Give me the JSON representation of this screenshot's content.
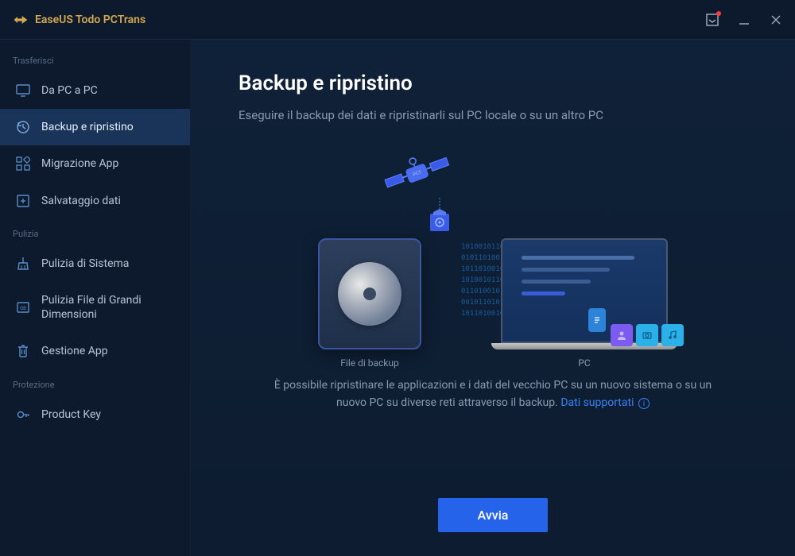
{
  "app": {
    "name": "EaseUS Todo PCTrans"
  },
  "sidebar": {
    "sections": [
      {
        "label": "Trasferisci",
        "items": [
          {
            "label": "Da PC a PC",
            "icon": "monitor-icon"
          },
          {
            "label": "Backup e ripristino",
            "icon": "restore-icon",
            "active": true
          },
          {
            "label": "Migrazione App",
            "icon": "apps-icon"
          },
          {
            "label": "Salvataggio dati",
            "icon": "save-icon"
          }
        ]
      },
      {
        "label": "Pulizia",
        "items": [
          {
            "label": "Pulizia di Sistema",
            "icon": "broom-icon"
          },
          {
            "label": "Pulizia File di Grandi Dimensioni",
            "icon": "large-file-icon"
          },
          {
            "label": "Gestione App",
            "icon": "trash-icon"
          }
        ]
      },
      {
        "label": "Protezione",
        "items": [
          {
            "label": "Product Key",
            "icon": "key-icon"
          }
        ]
      }
    ]
  },
  "page": {
    "title": "Backup e ripristino",
    "subtitle": "Eseguire il backup dei dati e ripristinarli sul PC locale o su un altro PC",
    "illus_left_label": "File di backup",
    "illus_right_label": "PC",
    "desc_a": "È possibile ripristinare le applicazioni e i dati del vecchio PC su un nuovo sistema o su un nuovo PC su diverse reti attraverso il backup. ",
    "link_text": "Dati supportati",
    "cta": "Avvia"
  }
}
